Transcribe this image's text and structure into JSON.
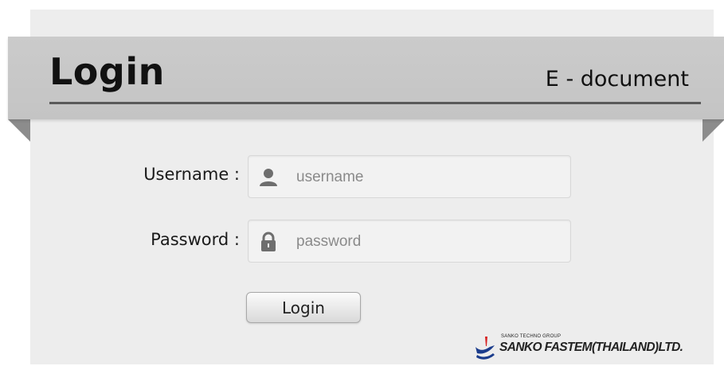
{
  "header": {
    "title": "Login",
    "subtitle": "E - document"
  },
  "form": {
    "username_label": "Username :",
    "username_placeholder": "username",
    "username_value": "",
    "password_label": "Password :",
    "password_placeholder": "password",
    "password_value": "",
    "submit_label": "Login"
  },
  "footer": {
    "group_text": "SANKO TECHNO GROUP",
    "company_name": "SANKO FASTEM(THAILAND)LTD."
  },
  "icons": {
    "username": "user-icon",
    "password": "lock-icon",
    "logo": "sanko-logo-icon"
  },
  "colors": {
    "ribbon": "#c8c8c8",
    "card": "#ededed",
    "logo_red": "#d62020",
    "logo_blue": "#1b3c8c"
  }
}
